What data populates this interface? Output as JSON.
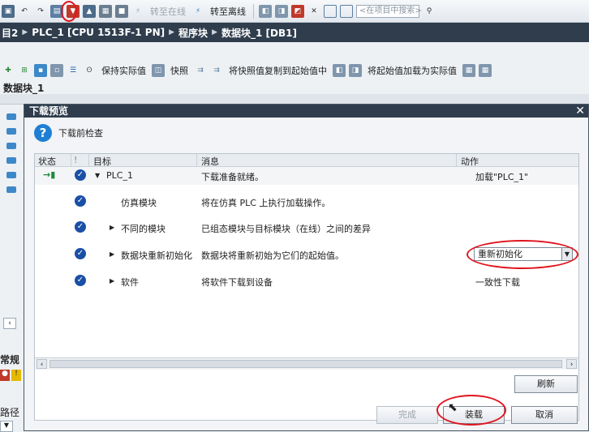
{
  "toolbar": {
    "go_online": "转至在线",
    "go_offline": "转至离线",
    "search_placeholder": "<在项目中搜索>"
  },
  "breadcrumb": {
    "items": [
      "目2",
      "PLC_1 [CPU 1513F-1 PN]",
      "程序块",
      "数据块_1 [DB1]"
    ]
  },
  "editor_toolbar": {
    "keep_actual": "保持实际值",
    "snapshot": "快照",
    "copy_snapshot": "将快照值复制到起始值中",
    "load_start": "将起始值加载为实际值"
  },
  "editor": {
    "title": "数据块_1",
    "bottom_label": "常规",
    "path_label": "路径"
  },
  "dialog": {
    "title": "下载预览",
    "heading": "下载前检查",
    "columns": {
      "status": "状态",
      "target": "目标",
      "message": "消息",
      "action": "动作"
    },
    "rows": [
      {
        "target": "PLC_1",
        "message": "下载准备就绪。",
        "action": "加载\"PLC_1\""
      },
      {
        "target": "仿真模块",
        "message": "将在仿真 PLC 上执行加载操作。",
        "action": ""
      },
      {
        "target": "不同的模块",
        "message": "已组态模块与目标模块（在线）之间的差异",
        "action": ""
      },
      {
        "target": "数据块重新初始化",
        "message": "数据块将重新初始为它们的起始值。",
        "action": "重新初始化"
      },
      {
        "target": "软件",
        "message": "将软件下载到设备",
        "action": "一致性下载"
      }
    ],
    "buttons": {
      "refresh": "刷新",
      "finish": "完成",
      "load": "装载",
      "cancel": "取消"
    }
  },
  "colors": {
    "title_bar": "#2f3d4d",
    "highlight_ring": "#e0141e",
    "check": "#1a4fa6"
  }
}
